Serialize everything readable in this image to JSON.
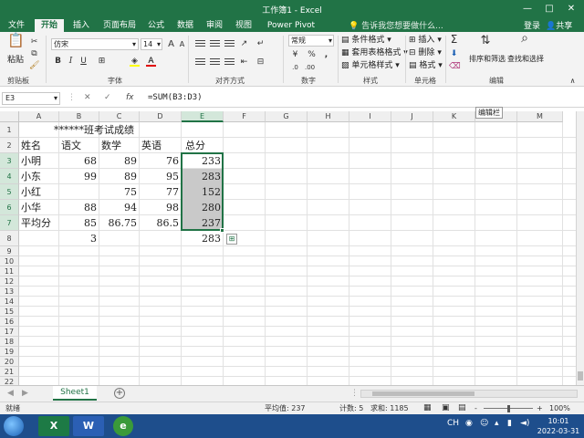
{
  "window": {
    "title": "工作簿1 - Excel",
    "minimize": "—",
    "maximize": "□",
    "close": "✕"
  },
  "tabs": [
    "文件",
    "开始",
    "插入",
    "页面布局",
    "公式",
    "数据",
    "审阅",
    "视图",
    "Power Pivot"
  ],
  "active_tab": "开始",
  "tell_me": "告诉我您想要做什么...",
  "login": "登录",
  "share": "共享",
  "ribbon": {
    "groups": {
      "clipboard": "剪贴板",
      "font": "字体",
      "alignment": "对齐方式",
      "number": "数字",
      "styles": "样式",
      "cells": "单元格",
      "editing": "编辑"
    },
    "paste": "粘贴",
    "font_name": "仿宋",
    "font_size": "14",
    "bold": "B",
    "italic": "I",
    "underline": "U",
    "number_format": "常规",
    "percent": "%",
    "comma": ",",
    "conditional_format": "条件格式",
    "table_format": "套用表格格式",
    "cell_styles": "单元格样式",
    "insert": "插入",
    "delete": "删除",
    "format": "格式",
    "sort_filter": "排序和筛选",
    "find_select": "查找和选择"
  },
  "formula_bar": {
    "name_box": "E3",
    "formula": "=SUM(B3:D3)",
    "cancel": "✕",
    "enter": "✓",
    "fx": "fx",
    "edit_tip": "编辑栏"
  },
  "columns": [
    "A",
    "B",
    "C",
    "D",
    "E",
    "F",
    "G",
    "H",
    "I",
    "J",
    "K",
    "L",
    "M"
  ],
  "rows": [
    "1",
    "2",
    "3",
    "4",
    "5",
    "6",
    "7",
    "8",
    "9",
    "10",
    "11",
    "12",
    "13",
    "14",
    "15",
    "16",
    "17",
    "18",
    "19",
    "20",
    "21",
    "22",
    "23",
    "24",
    "25"
  ],
  "cells": {
    "title": "******班考试成绩",
    "headers": [
      "姓名",
      "语文",
      "数学",
      "英语",
      "总分"
    ],
    "data": [
      [
        "小明",
        "68",
        "89",
        "76",
        "233"
      ],
      [
        "小东",
        "99",
        "89",
        "95",
        "283"
      ],
      [
        "小红",
        "",
        "75",
        "77",
        "152"
      ],
      [
        "小华",
        "88",
        "94",
        "98",
        "280"
      ],
      [
        "平均分",
        "85",
        "86.75",
        "86.5",
        "237"
      ],
      [
        "",
        "3",
        "",
        "",
        "283"
      ]
    ]
  },
  "sheet": {
    "tab": "Sheet1",
    "add": "+"
  },
  "status": {
    "ready": "就绪",
    "average": "平均值: 237",
    "count": "计数: 5",
    "sum": "求和: 1185",
    "zoom": "100%",
    "zoom_minus": "-",
    "zoom_plus": "+"
  },
  "taskbar": {
    "excel": "X",
    "word": "W",
    "time": "10:01",
    "date": "2022-03-31",
    "lang": "CH"
  },
  "colors": {
    "accent": "#217346",
    "selection": "#c9c9c9"
  }
}
